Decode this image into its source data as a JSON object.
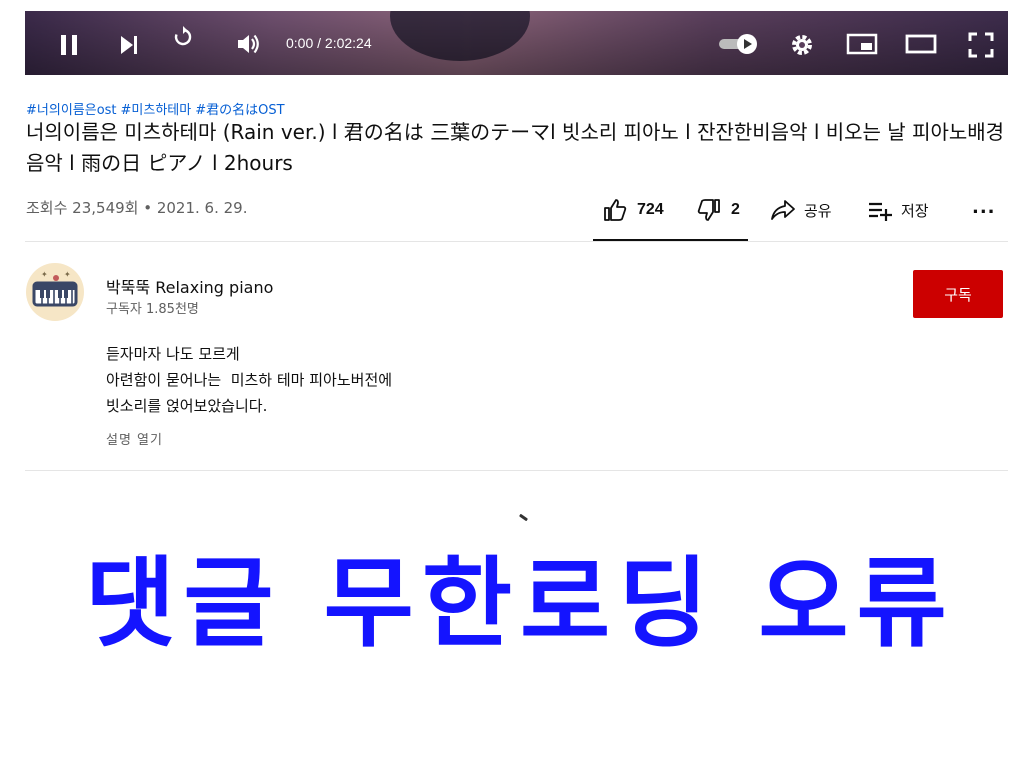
{
  "player": {
    "time": "0:00 / 2:02:24"
  },
  "video": {
    "hashtags": [
      "#너의이름은ost",
      "#미츠하테마",
      "#君の名はOST"
    ],
    "title": "너의이름은 미츠하테마 (Rain ver.) l 君の名は 三葉のテーマl 빗소리 피아노 l 잔잔한비음악 l 비오는 날 피아노배경음악 l 雨の日 ピアノ l 2hours",
    "views": "조회수 23,549회 • 2021. 6. 29."
  },
  "actions": {
    "likes": "724",
    "dislikes": "2",
    "share_label": "공유",
    "save_label": "저장",
    "more_label": "..."
  },
  "channel": {
    "name": "박뚝뚝 Relaxing piano",
    "subscribers": "구독자 1.85천명",
    "subscribe_label": "구독"
  },
  "description": {
    "lines": [
      "듣자마자 나도 모르게",
      "아련함이 묻어나는  미츠하 테마 피아노버전에",
      "빗소리를 얹어보았습니다."
    ],
    "more_label": "설명 열기"
  },
  "overlay": {
    "text": "댓글 무한로딩 오류"
  },
  "colors": {
    "subscribe_red": "#cc0000",
    "hashtag_blue": "#065fd4",
    "overlay_blue": "#1414ff"
  }
}
